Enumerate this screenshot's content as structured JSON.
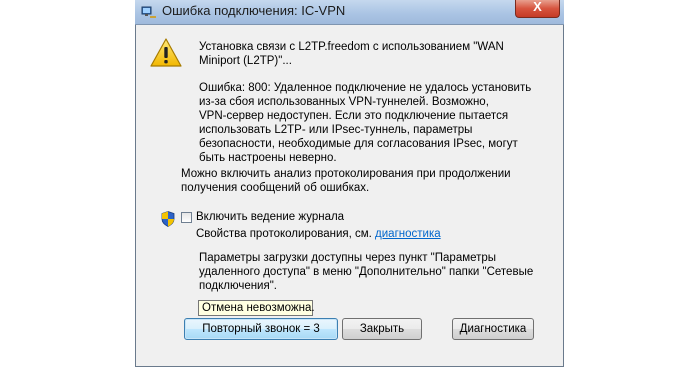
{
  "window": {
    "title": "Ошибка подключения: IC-VPN",
    "close_label": "X"
  },
  "message": {
    "status_line1": "Установка связи с L2TP.freedom с использованием \"WAN",
    "status_line2": "Miniport (L2TP)\"...",
    "error_lines": [
      "Ошибка: 800: Удаленное подключение не удалось установить",
      "из-за сбоя использованных VPN-туннелей. Возможно,",
      "VPN-сервер недоступен. Если это подключение пытается",
      "использовать L2TP- или IPsec-туннель, параметры",
      "безопасности, необходимые для согласования IPsec, могут",
      "быть настроены неверно."
    ],
    "logging_lines": [
      "Можно включить анализ протоколирования при продолжении",
      "получения сообщений об ошибках."
    ]
  },
  "logging": {
    "checkbox_label": "Включить ведение журнала",
    "props_text": "Свойства протоколирования, см.",
    "diag_link": "диагностика"
  },
  "params_lines": [
    "Параметры загрузки доступны через пункт \"Параметры",
    "удаленного доступа\" в меню \"Дополнительно\" папки \"Сетевые",
    "подключения\"."
  ],
  "tooltip": "Отмена невозможна.",
  "buttons": {
    "redial": "Повторный звонок = 3",
    "close": "Закрыть",
    "diagnostics": "Диагностика"
  },
  "icons": {
    "title": "network-icon",
    "warning": "warning-icon",
    "shield": "uac-shield-icon"
  }
}
